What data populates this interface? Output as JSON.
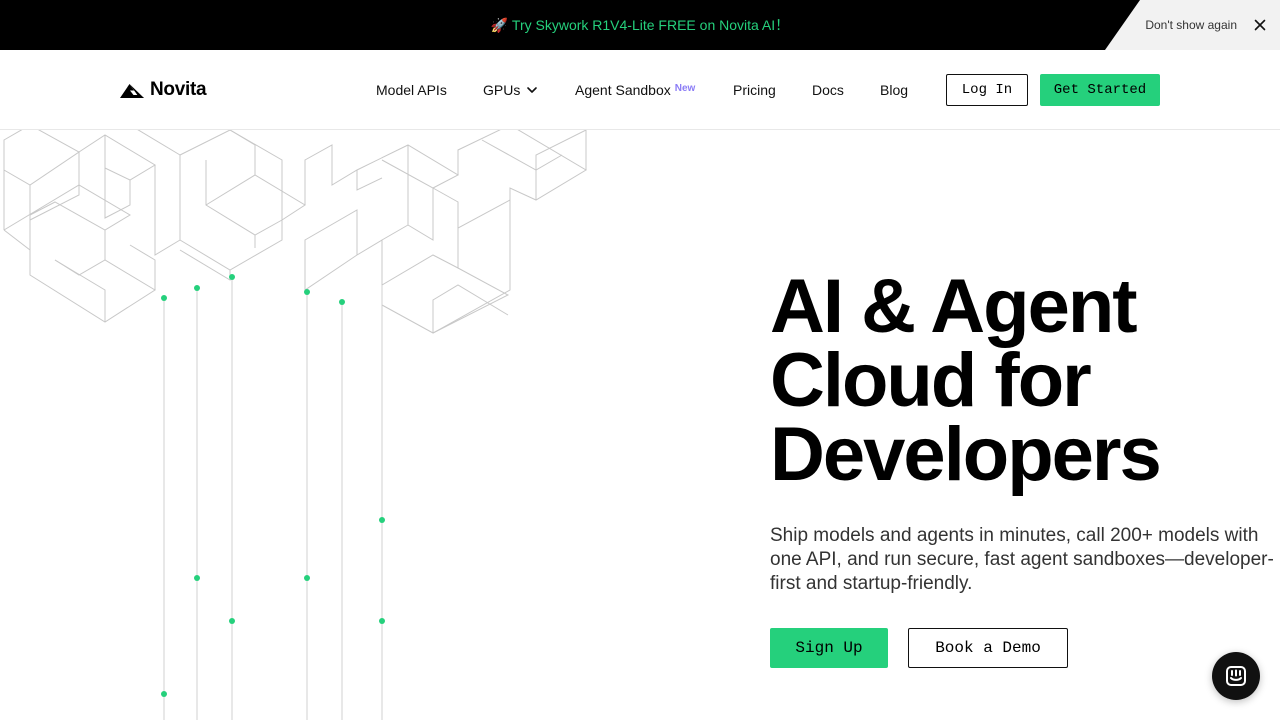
{
  "announcement": {
    "text": "🚀 Try Skywork R1V4-Lite FREE on Novita AI！",
    "dismiss_label": "Don't show again",
    "close_icon": "close-icon"
  },
  "navbar": {
    "brand": "Novita",
    "items": [
      {
        "label": "Model APIs"
      },
      {
        "label": "GPUs"
      },
      {
        "label": "Agent Sandbox",
        "badge": "New"
      },
      {
        "label": "Pricing"
      },
      {
        "label": "Docs"
      },
      {
        "label": "Blog"
      }
    ],
    "login_label": "Log In",
    "cta_label": "Get Started"
  },
  "hero": {
    "title_line1": "AI & Agent",
    "title_line2": "Cloud for",
    "title_line3": "Developers",
    "subtitle": "Ship models and agents in minutes, call 200+ models with one API, and run secure, fast agent sandboxes—developer-first and startup-friendly.",
    "primary_cta": "Sign Up",
    "secondary_cta": "Book a Demo"
  },
  "colors": {
    "accent": "#25d07c",
    "badge": "#8b7cf6",
    "text": "#000000"
  },
  "icons": [
    "close-icon",
    "chevron-down-icon",
    "novita-logo-icon",
    "chat-icon"
  ]
}
